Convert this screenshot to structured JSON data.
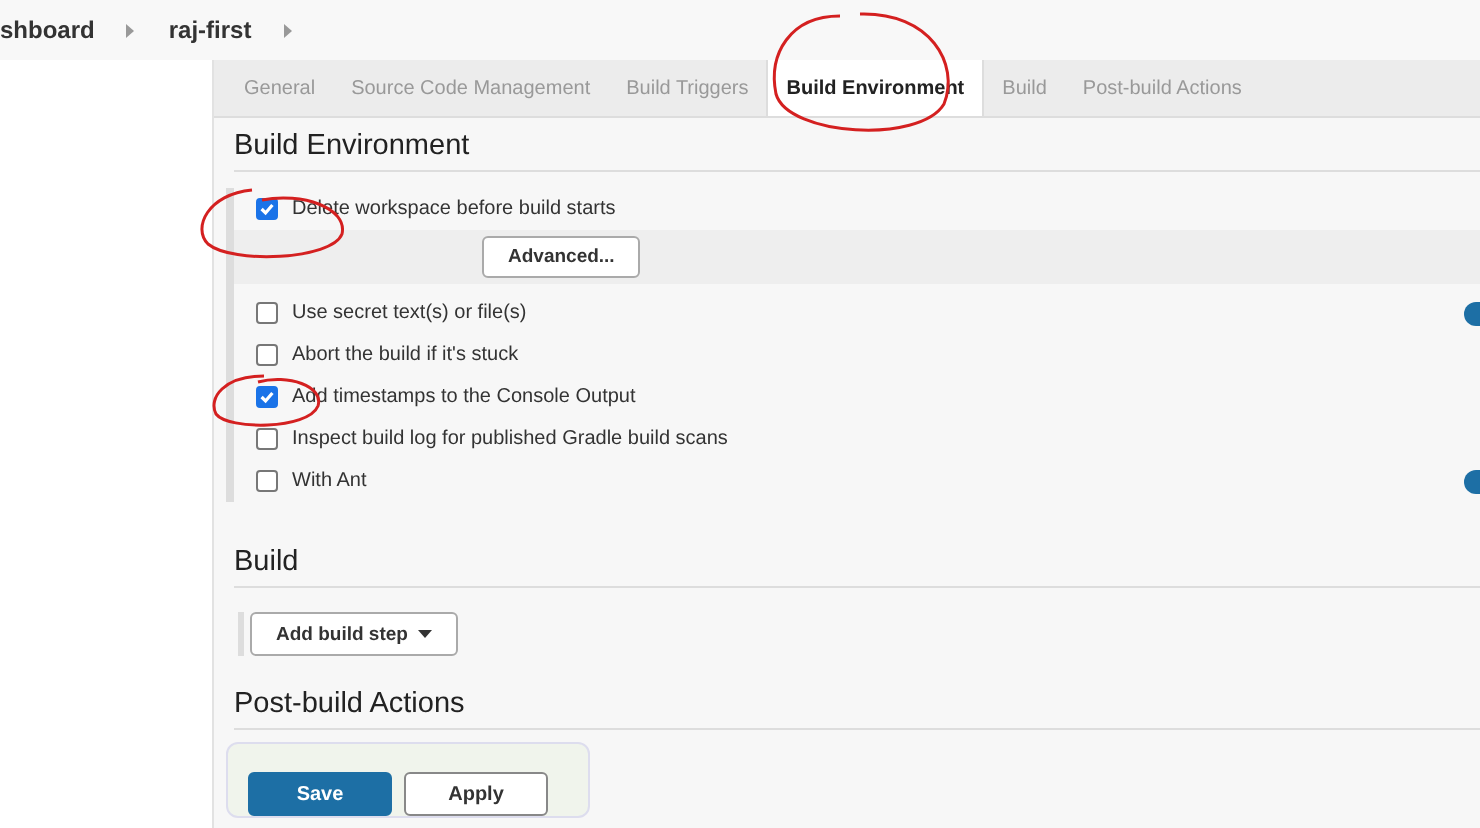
{
  "breadcrumbs": [
    {
      "label": "shboard"
    },
    {
      "label": "raj-first"
    }
  ],
  "tabs": [
    {
      "label": "General",
      "selected": false
    },
    {
      "label": "Source Code Management",
      "selected": false
    },
    {
      "label": "Build Triggers",
      "selected": false
    },
    {
      "label": "Build Environment",
      "selected": true
    },
    {
      "label": "Build",
      "selected": false
    },
    {
      "label": "Post-build Actions",
      "selected": false
    }
  ],
  "build_environment": {
    "title": "Build Environment",
    "options": [
      {
        "label": "Delete workspace before build starts",
        "checked": true,
        "button": "Advanced...",
        "help": false
      },
      {
        "label": "Use secret text(s) or file(s)",
        "checked": false,
        "help": true
      },
      {
        "label": "Abort the build if it's stuck",
        "checked": false,
        "help": false
      },
      {
        "label": "Add timestamps to the Console Output",
        "checked": true,
        "help": false
      },
      {
        "label": "Inspect build log for published Gradle build scans",
        "checked": false,
        "help": false
      },
      {
        "label": "With Ant",
        "checked": false,
        "help": true
      }
    ]
  },
  "build": {
    "title": "Build",
    "button": "Add build step"
  },
  "post_build": {
    "title": "Post-build Actions"
  },
  "actions": [
    {
      "label": "Save",
      "kind": "primary"
    },
    {
      "label": "Apply",
      "kind": "secondary"
    }
  ]
}
